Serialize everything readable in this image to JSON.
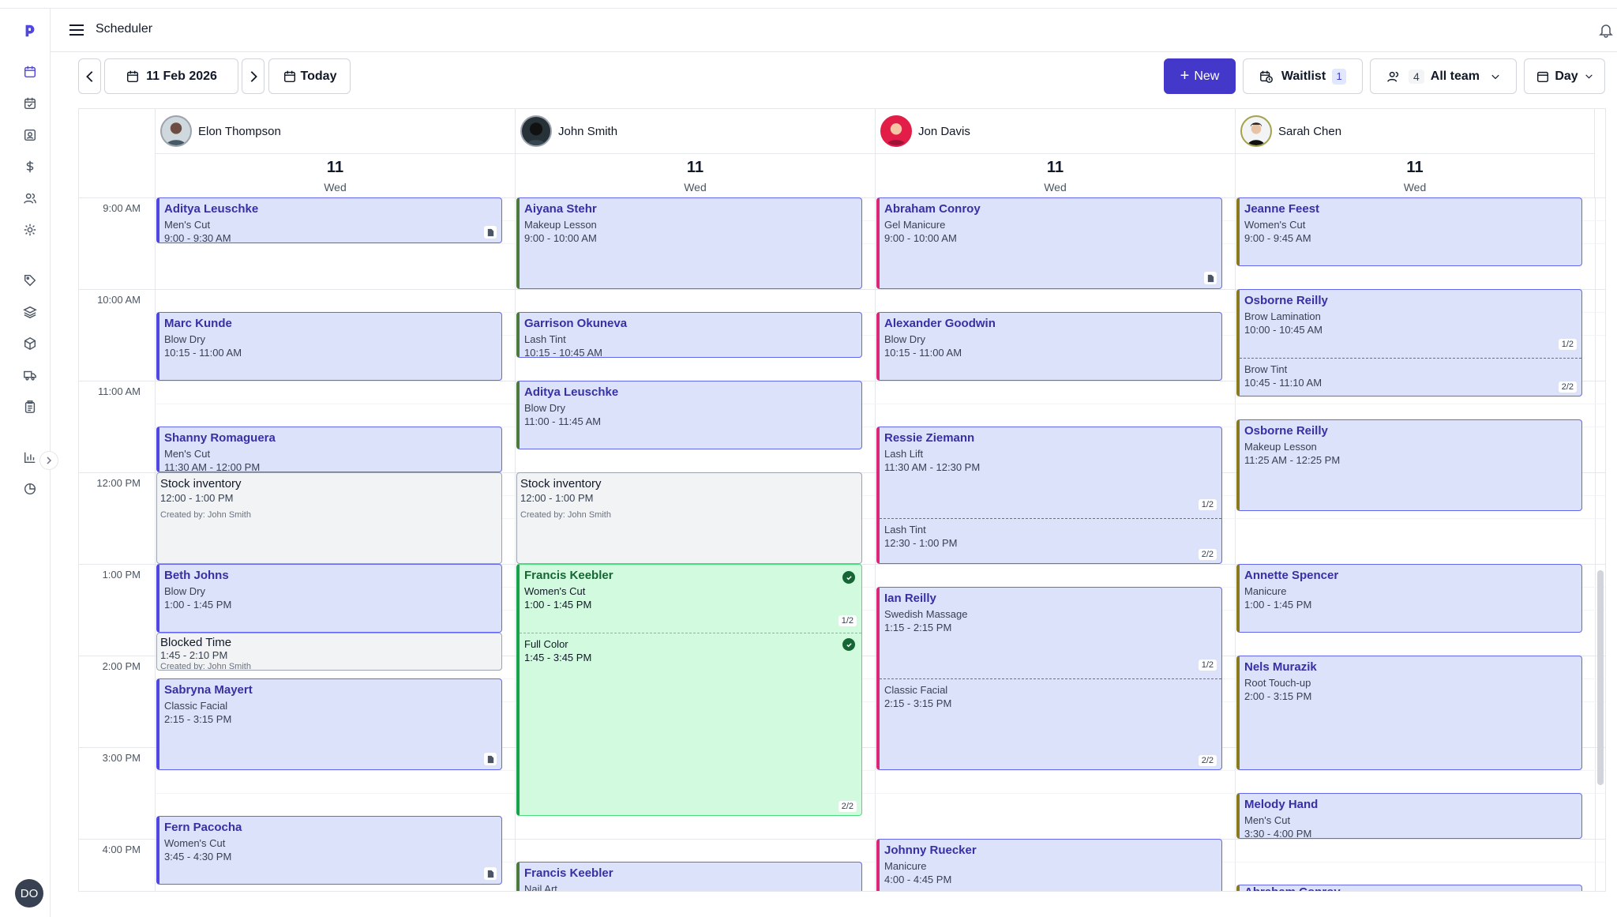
{
  "app": {
    "title": "Scheduler",
    "user_initials": "DO"
  },
  "toolbar": {
    "date_label": "11 Feb 2026",
    "today_label": "Today",
    "new_label": "New",
    "waitlist_label": "Waitlist",
    "waitlist_count": "1",
    "team_count": "4",
    "team_label": "All team",
    "view_label": "Day"
  },
  "staff": [
    {
      "name": "Elon Thompson",
      "day_num": "11",
      "weekday": "Wed"
    },
    {
      "name": "John Smith",
      "day_num": "11",
      "weekday": "Wed"
    },
    {
      "name": "Jon Davis",
      "day_num": "11",
      "weekday": "Wed"
    },
    {
      "name": "Sarah Chen",
      "day_num": "11",
      "weekday": "Wed"
    }
  ],
  "time_labels": [
    "9:00 AM",
    "10:00 AM",
    "11:00 AM",
    "12:00 PM",
    "1:00 PM",
    "2:00 PM",
    "3:00 PM",
    "4:00 PM"
  ],
  "appointments": {
    "col0": [
      {
        "client": "Aditya Leuschke",
        "service": "Men's Cut",
        "time": "9:00 - 9:30 AM"
      },
      {
        "client": "Marc Kunde",
        "service": "Blow Dry",
        "time": "10:15 - 11:00 AM"
      },
      {
        "client": "Shanny Romaguera",
        "service": "Men's Cut",
        "time": "11:30 AM - 12:00 PM"
      },
      {
        "client": "Stock inventory",
        "time": "12:00 - 1:00 PM",
        "note": "Created by: John Smith"
      },
      {
        "client": "Beth Johns",
        "service": "Blow Dry",
        "time": "1:00 - 1:45 PM"
      },
      {
        "client": "Blocked Time",
        "time": "1:45 - 2:10 PM",
        "note": "Created by: John Smith"
      },
      {
        "client": "Sabryna Mayert",
        "service": "Classic Facial",
        "time": "2:15 - 3:15 PM"
      },
      {
        "client": "Fern Pacocha",
        "service": "Women's Cut",
        "time": "3:45 - 4:30 PM"
      }
    ],
    "col1": [
      {
        "client": "Aiyana Stehr",
        "service": "Makeup Lesson",
        "time": "9:00 - 10:00 AM"
      },
      {
        "client": "Garrison Okuneva",
        "service": "Lash Tint",
        "time": "10:15 - 10:45 AM"
      },
      {
        "client": "Aditya Leuschke",
        "service": "Blow Dry",
        "time": "11:00 - 11:45 AM"
      },
      {
        "client": "Stock inventory",
        "time": "12:00 - 1:00 PM",
        "note": "Created by: John Smith"
      },
      {
        "client": "Francis Keebler",
        "service": "Women's Cut",
        "time": "1:00 - 1:45 PM",
        "badge": "1/2",
        "service2": "Full Color",
        "time2": "1:45 - 3:45 PM",
        "badge2": "2/2"
      },
      {
        "client": "Francis Keebler",
        "service": "Nail Art"
      }
    ],
    "col2": [
      {
        "client": "Abraham Conroy",
        "service": "Gel Manicure",
        "time": "9:00 - 10:00 AM"
      },
      {
        "client": "Alexander Goodwin",
        "service": "Blow Dry",
        "time": "10:15 - 11:00 AM"
      },
      {
        "client": "Ressie Ziemann",
        "service": "Lash Lift",
        "time": "11:30 AM - 12:30 PM",
        "badge": "1/2",
        "service2": "Lash Tint",
        "time2": "12:30 - 1:00 PM",
        "badge2": "2/2"
      },
      {
        "client": "Ian Reilly",
        "service": "Swedish Massage",
        "time": "1:15 - 2:15 PM",
        "badge": "1/2",
        "service2": "Classic Facial",
        "time2": "2:15 - 3:15 PM",
        "badge2": "2/2"
      },
      {
        "client": "Johnny Ruecker",
        "service": "Manicure",
        "time": "4:00 - 4:45 PM"
      }
    ],
    "col3": [
      {
        "client": "Jeanne Feest",
        "service": "Women's Cut",
        "time": "9:00 - 9:45 AM"
      },
      {
        "client": "Osborne Reilly",
        "service": "Brow Lamination",
        "time": "10:00 - 10:45 AM",
        "badge": "1/2",
        "service2": "Brow Tint",
        "time2": "10:45 - 11:10 AM",
        "badge2": "2/2"
      },
      {
        "client": "Osborne Reilly",
        "service": "Makeup Lesson",
        "time": "11:25 AM - 12:25 PM"
      },
      {
        "client": "Annette Spencer",
        "service": "Manicure",
        "time": "1:00 - 1:45 PM"
      },
      {
        "client": "Nels Murazik",
        "service": "Root Touch-up",
        "time": "2:00 - 3:15 PM"
      },
      {
        "client": "Melody Hand",
        "service": "Men's Cut",
        "time": "3:30 - 4:00 PM"
      },
      {
        "client": "Abraham Conroy"
      }
    ]
  },
  "colors": {
    "accent": "#4338ca",
    "appt_bg": "#dde2fb",
    "done_bg": "#d1fadf",
    "block_bg": "#f1f3f5"
  }
}
